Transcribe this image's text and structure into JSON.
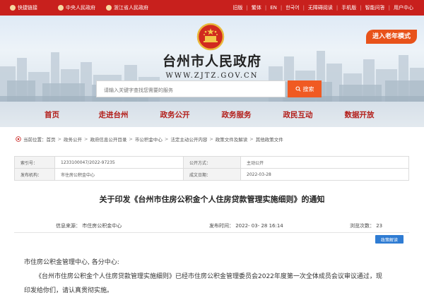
{
  "topbar": {
    "quick_link": "快捷链接",
    "link_central": "中央人民政府",
    "link_province": "浙江省人民政府",
    "utility": [
      "旧版",
      "繁体",
      "EN",
      "한국어",
      "无障碍阅读",
      "手机版",
      "智能问答",
      "用户中心"
    ]
  },
  "header": {
    "title": "台州市人民政府",
    "domain": "WWW.ZJTZ.GOV.CN",
    "elder_mode": "进入老年模式"
  },
  "search": {
    "placeholder": "请输入关键字查找您需要的服务",
    "button": "搜索"
  },
  "nav": [
    "首页",
    "走进台州",
    "政务公开",
    "政务服务",
    "政民互动",
    "数据开放"
  ],
  "breadcrumb": {
    "prefix": "当前位置：",
    "items": [
      "首页",
      "政务公开",
      "政府信息公开目录",
      "市公积金中心",
      "法定主动公开内容",
      "政策文件及解读",
      "其他政策文件"
    ]
  },
  "info_table": {
    "index_label": "索引号：",
    "index_value": "1233100047/2022-97235",
    "category_label": "公开方式：",
    "category_value": "主动公开",
    "issuer_label": "发布机构：",
    "issuer_value": "市住房公积金中心",
    "date_label": "成文日期：",
    "date_value": "2022-03-28"
  },
  "article": {
    "title": "关于印发《台州市住房公积金个人住房贷款管理实施细则》的通知",
    "source": "信息来源：  市住房公积金中心",
    "publish_time": "发布时间： 2022- 03- 28 16:14",
    "views": "浏览次数：  23",
    "policy_button": "政策解读",
    "para1": "市住房公积金管理中心, 各分中心:",
    "para2": "《台州市住房公积金个人住房贷款管理实施细则》已经市住房公积金管理委员会2022年度第一次全体成员会议审议通过，现",
    "para3": "印发给你们，请认真贯彻实施。"
  },
  "colors": {
    "brand_red": "#c8201d",
    "nav_text": "#b31e1a",
    "search_orange": "#f05a22",
    "elder_orange": "#e8521a",
    "policy_blue": "#2f7cd3"
  }
}
